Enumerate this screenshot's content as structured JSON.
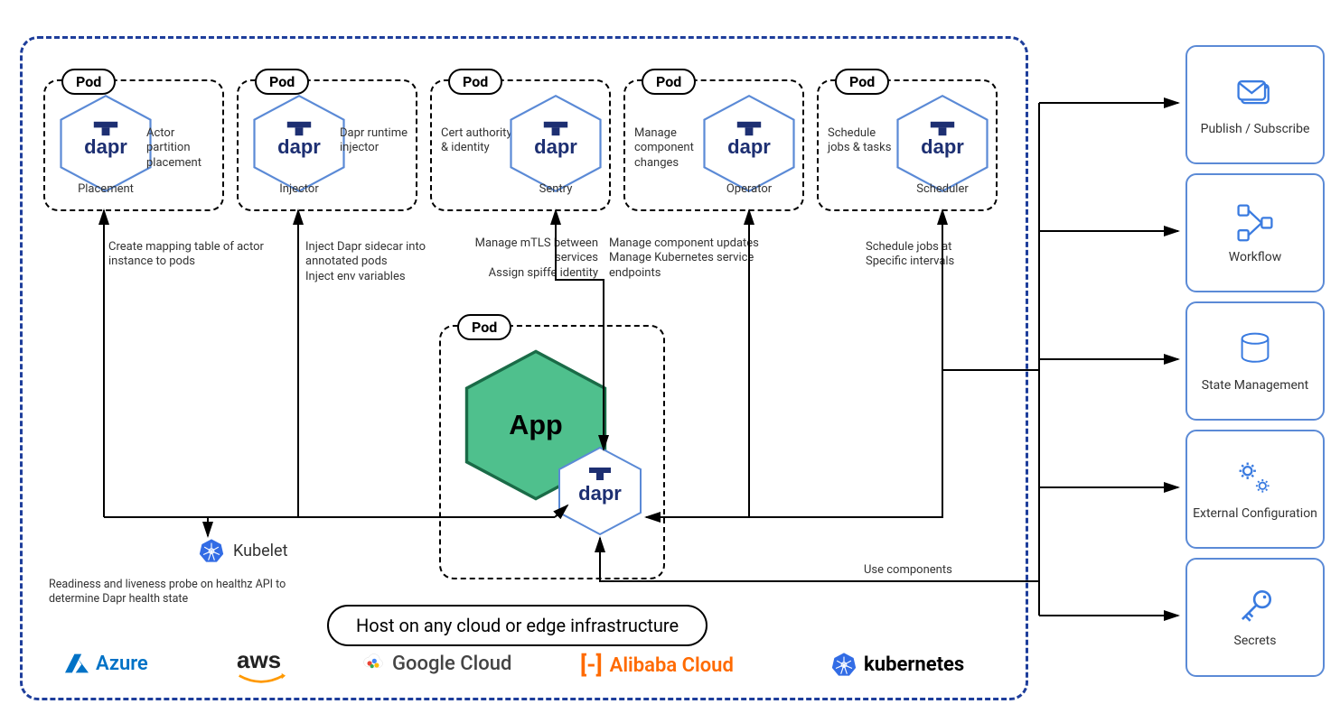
{
  "podLabel": "Pod",
  "controlPods": [
    {
      "name": "Placement",
      "desc": "Actor partition placement",
      "arrowLabel": "Create mapping table of actor instance to pods"
    },
    {
      "name": "Injector",
      "desc": "Dapr runtime injector",
      "arrowLabel": "Inject Dapr sidecar into annotated pods\nInject env variables"
    },
    {
      "name": "Sentry",
      "desc": "Cert authority & identity",
      "arrowLabel": "Manage mTLS between services\nAssign spiffe identity"
    },
    {
      "name": "Operator",
      "desc": "Manage component changes",
      "arrowLabel": "Manage component updates\nManage Kubernetes service endpoints"
    },
    {
      "name": "Scheduler",
      "desc": "Schedule jobs & tasks",
      "arrowLabel": "Schedule jobs at Specific intervals"
    }
  ],
  "appPod": {
    "label": "App",
    "sidecar": "dapr"
  },
  "useComponents": "Use components",
  "kubelet": {
    "label": "Kubelet",
    "note": "Readiness and liveness probe on healthz API to determine Dapr health state"
  },
  "hostCapsule": "Host on any cloud or edge infrastructure",
  "clouds": [
    "Azure",
    "aws",
    "Google Cloud",
    "Alibaba Cloud",
    "kubernetes"
  ],
  "services": [
    "Publish / Subscribe",
    "Workflow",
    "State Management",
    "External Configuration",
    "Secrets"
  ],
  "daprWord": "dapr"
}
